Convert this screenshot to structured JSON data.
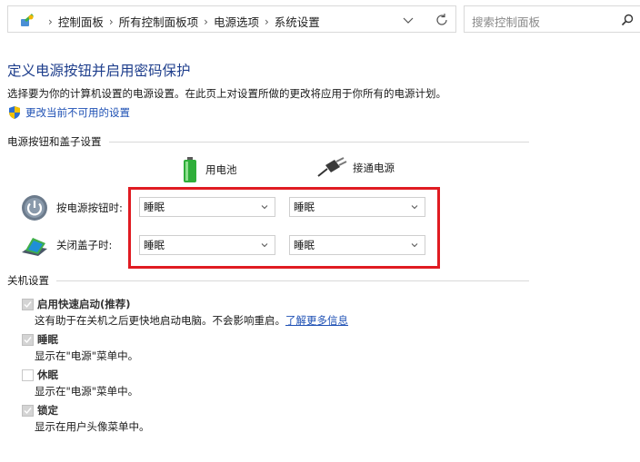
{
  "breadcrumb": [
    "控制面板",
    "所有控制面板项",
    "电源选项",
    "系统设置"
  ],
  "search": {
    "placeholder": "搜索控制面板"
  },
  "page": {
    "title": "定义电源按钮并启用密码保护",
    "description": "选择要为你的计算机设置的电源设置。在此页上对设置所做的更改将应用于你所有的电源计划。",
    "change_link": "更改当前不可用的设置"
  },
  "power_section": {
    "heading": "电源按钮和盖子设置",
    "columns": {
      "battery": "用电池",
      "plugged": "接通电源"
    },
    "rows": [
      {
        "label": "按电源按钮时:",
        "battery": "睡眠",
        "plugged": "睡眠"
      },
      {
        "label": "关闭盖子时:",
        "battery": "睡眠",
        "plugged": "睡眠"
      }
    ]
  },
  "shutdown_section": {
    "heading": "关机设置",
    "options": [
      {
        "title": "启用快速启动(推荐)",
        "desc": "这有助于在关机之后更快地启动电脑。不会影响重启。",
        "link": "了解更多信息",
        "checked": true
      },
      {
        "title": "睡眠",
        "desc": "显示在\"电源\"菜单中。",
        "checked": true
      },
      {
        "title": "休眠",
        "desc": "显示在\"电源\"菜单中。",
        "checked": false
      },
      {
        "title": "锁定",
        "desc": "显示在用户头像菜单中。",
        "checked": true
      }
    ]
  },
  "colors": {
    "highlight": "#e01b22",
    "title": "#1e3e8c",
    "link": "#1e50b4"
  }
}
